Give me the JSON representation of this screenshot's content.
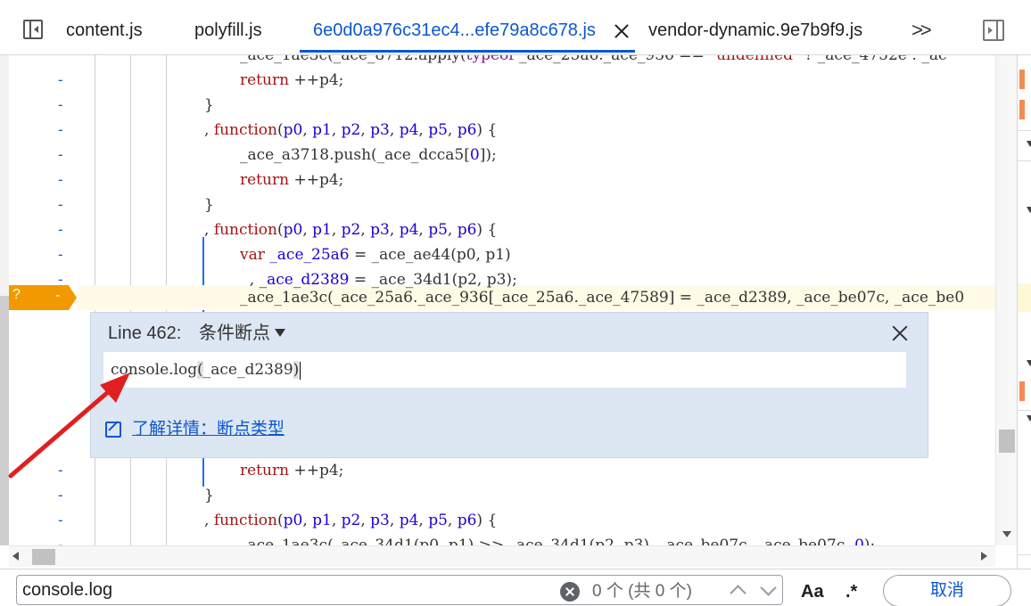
{
  "tabs": [
    {
      "label": "content.js"
    },
    {
      "label": "polyfill.js"
    },
    {
      "label": "6e0d0a976c31ec4...efe79a8c678.js",
      "active": true
    },
    {
      "label": "vendor-dynamic.9e7b9f9.js"
    }
  ],
  "more_tabs_label": ">>",
  "gutter_marker": "-",
  "code_lines": [
    {
      "id": 0,
      "parts": [
        [
          "plain",
          "_ace_1ae3c(_ace_8712.apply("
        ],
        [
          "kw2",
          "typeof"
        ],
        [
          "plain",
          " _ace_25a6._ace_936 == "
        ],
        [
          "kw",
          "\"undefined\""
        ],
        [
          "plain",
          " ? _ace_4752e : _ac"
        ]
      ]
    },
    {
      "id": 1,
      "parts": [
        [
          "kw",
          "return"
        ],
        [
          "plain",
          " ++p4;"
        ]
      ]
    },
    {
      "id": 2,
      "parts": [
        [
          "plain",
          "}"
        ]
      ]
    },
    {
      "id": 3,
      "parts": [
        [
          "plain",
          ", "
        ],
        [
          "kw",
          "function"
        ],
        [
          "plain",
          "("
        ],
        [
          "param",
          "p0"
        ],
        [
          "plain",
          ", "
        ],
        [
          "param",
          "p1"
        ],
        [
          "plain",
          ", "
        ],
        [
          "param",
          "p2"
        ],
        [
          "plain",
          ", "
        ],
        [
          "param",
          "p3"
        ],
        [
          "plain",
          ", "
        ],
        [
          "param",
          "p4"
        ],
        [
          "plain",
          ", "
        ],
        [
          "param",
          "p5"
        ],
        [
          "plain",
          ", "
        ],
        [
          "param",
          "p6"
        ],
        [
          "plain",
          ") {"
        ]
      ]
    },
    {
      "id": 4,
      "parts": [
        [
          "plain",
          "_ace_a3718.push(_ace_dcca5["
        ],
        [
          "param",
          "0"
        ],
        [
          "plain",
          "]);"
        ]
      ]
    },
    {
      "id": 5,
      "parts": [
        [
          "kw",
          "return"
        ],
        [
          "plain",
          " ++p4;"
        ]
      ]
    },
    {
      "id": 6,
      "parts": [
        [
          "plain",
          "}"
        ]
      ]
    },
    {
      "id": 7,
      "parts": [
        [
          "plain",
          ", "
        ],
        [
          "kw",
          "function"
        ],
        [
          "plain",
          "("
        ],
        [
          "param",
          "p0"
        ],
        [
          "plain",
          ", "
        ],
        [
          "param",
          "p1"
        ],
        [
          "plain",
          ", "
        ],
        [
          "param",
          "p2"
        ],
        [
          "plain",
          ", "
        ],
        [
          "param",
          "p3"
        ],
        [
          "plain",
          ", "
        ],
        [
          "param",
          "p4"
        ],
        [
          "plain",
          ", "
        ],
        [
          "param",
          "p5"
        ],
        [
          "plain",
          ", "
        ],
        [
          "param",
          "p6"
        ],
        [
          "plain",
          ") {"
        ]
      ]
    },
    {
      "id": 8,
      "parts": [
        [
          "kw",
          "var"
        ],
        [
          "plain",
          " "
        ],
        [
          "param",
          "_ace_25a6"
        ],
        [
          "plain",
          " = _ace_ae44(p0, p1)"
        ]
      ]
    },
    {
      "id": 9,
      "parts": [
        [
          "plain",
          "  , "
        ],
        [
          "param",
          "_ace_d2389"
        ],
        [
          "plain",
          " = _ace_34d1(p2, p3);"
        ]
      ]
    },
    {
      "id": 10,
      "parts": [
        [
          "plain",
          "_ace_1ae3c(_ace_25a6._ace_936[_ace_25a6._ace_47589] = _ace_d2389, _ace_be07c, _ace_be0"
        ]
      ]
    },
    {
      "id": 11,
      "parts": [
        [
          "kw",
          "return"
        ],
        [
          "plain",
          " ++p4;"
        ]
      ]
    },
    {
      "id": 12,
      "parts": [
        [
          "plain",
          "}"
        ]
      ]
    },
    {
      "id": 13,
      "parts": [
        [
          "plain",
          ", "
        ],
        [
          "kw",
          "function"
        ],
        [
          "plain",
          "("
        ],
        [
          "param",
          "p0"
        ],
        [
          "plain",
          ", "
        ],
        [
          "param",
          "p1"
        ],
        [
          "plain",
          ", "
        ],
        [
          "param",
          "p2"
        ],
        [
          "plain",
          ", "
        ],
        [
          "param",
          "p3"
        ],
        [
          "plain",
          ", "
        ],
        [
          "param",
          "p4"
        ],
        [
          "plain",
          ", "
        ],
        [
          "param",
          "p5"
        ],
        [
          "plain",
          ", "
        ],
        [
          "param",
          "p6"
        ],
        [
          "plain",
          ") {"
        ]
      ]
    },
    {
      "id": 14,
      "parts": [
        [
          "plain",
          "_ace_1ae3c(_ace_34d1(p0, p1) >> _ace_34d1(p2, p3), _ace_be07c, _ace_be07c, "
        ],
        [
          "param",
          "0"
        ],
        [
          "plain",
          ");"
        ]
      ]
    }
  ],
  "breakpoint_marker": {
    "symbol": "?",
    "dash": "-"
  },
  "breakpoint_editor": {
    "line_label": "Line 462:",
    "type_label": "条件断点",
    "condition_prefix": "console.log",
    "condition_open": "(",
    "condition_arg": "_ace_d2389",
    "condition_close": ")",
    "link_label": "了解详情：断点类型"
  },
  "search": {
    "value": "console.log",
    "match_count": "0 个 (共 0 个)",
    "case_option": "Aa",
    "regex_option": ".*",
    "cancel_label": "取消"
  },
  "colors": {
    "accent": "#0b57d0",
    "breakpoint": "#f29900",
    "annotation_arrow": "#e02020"
  }
}
